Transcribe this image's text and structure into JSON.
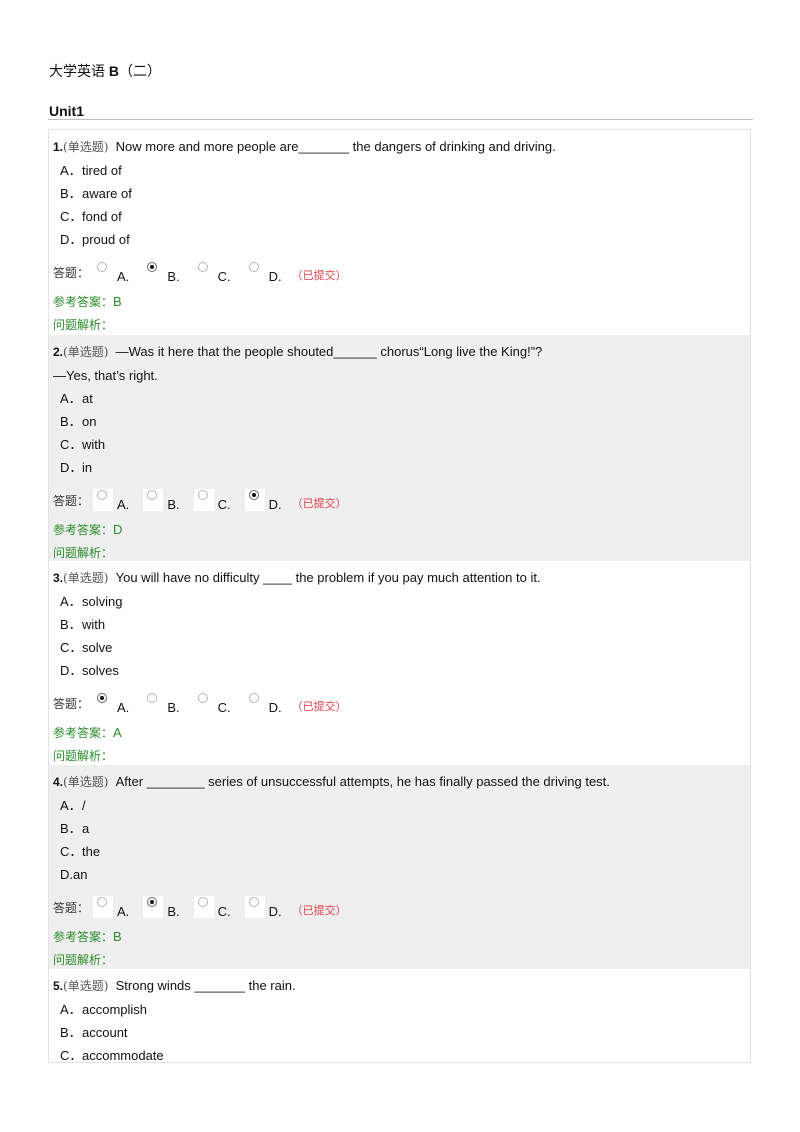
{
  "document": {
    "title_zh": "大学英语",
    "title_bold": "B",
    "title_suffix": "（二）",
    "unit": "Unit1"
  },
  "labels": {
    "answer_label": "答题：",
    "reference_label": "参考答案：",
    "explanation_label": "问题解析：",
    "submitted": "（已提交）"
  },
  "questions": [
    {
      "number": "1.",
      "type": "(单选题)",
      "stem": "Now more and more people are_______ the dangers of drinking and driving.",
      "continuation": "",
      "options": [
        {
          "letter": "A．",
          "text": "tired of"
        },
        {
          "letter": "B．",
          "text": "aware of"
        },
        {
          "letter": "C．",
          "text": "fond of"
        },
        {
          "letter": "D．",
          "text": "proud of"
        }
      ],
      "choice_labels": [
        "A.",
        "B.",
        "C.",
        "D."
      ],
      "selected": "B",
      "reference": "B",
      "explanation": ""
    },
    {
      "number": "2.",
      "type": "(单选题)",
      "stem": "—Was it here that the people shouted______ chorus“Long live the King!”?",
      "continuation": "—Yes, that’s right.",
      "options": [
        {
          "letter": "A．",
          "text": "at"
        },
        {
          "letter": "B．",
          "text": "on"
        },
        {
          "letter": "C．",
          "text": "with"
        },
        {
          "letter": "D．",
          "text": "in"
        }
      ],
      "choice_labels": [
        "A.",
        "B.",
        "C.",
        "D."
      ],
      "selected": "D",
      "reference": "D",
      "explanation": ""
    },
    {
      "number": "3.",
      "type": "(单选题)",
      "stem": "You will have no difficulty ____ the problem if you pay much attention to it.",
      "continuation": "",
      "options": [
        {
          "letter": "A．",
          "text": "solving"
        },
        {
          "letter": "B．",
          "text": "with"
        },
        {
          "letter": "C．",
          "text": "solve"
        },
        {
          "letter": "D．",
          "text": "solves"
        }
      ],
      "choice_labels": [
        "A.",
        "B.",
        "C.",
        "D."
      ],
      "selected": "A",
      "reference": "A",
      "explanation": ""
    },
    {
      "number": "4.",
      "type": "(单选题)",
      "stem": "After ________ series of unsuccessful attempts, he has finally passed the driving test.",
      "continuation": "",
      "options": [
        {
          "letter": "A．",
          "text": "/"
        },
        {
          "letter": "B．",
          "text": "a"
        },
        {
          "letter": "C．",
          "text": "the"
        },
        {
          "letter": "",
          "text": "D.an"
        }
      ],
      "choice_labels": [
        "A.",
        "B.",
        "C.",
        "D."
      ],
      "selected": "B",
      "reference": "B",
      "explanation": ""
    },
    {
      "number": "5.",
      "type": "(单选题)",
      "stem": "Strong winds _______ the rain.",
      "continuation": "",
      "options": [
        {
          "letter": "A．",
          "text": "accomplish"
        },
        {
          "letter": "B．",
          "text": "account"
        },
        {
          "letter": "C．",
          "text": "accommodate"
        }
      ],
      "choice_labels": [],
      "selected": "",
      "reference": "",
      "explanation": ""
    }
  ],
  "colors": {
    "reference_green": "#2a8c2a",
    "submitted_red": "#e0404a",
    "shaded_bg": "#efefef"
  }
}
